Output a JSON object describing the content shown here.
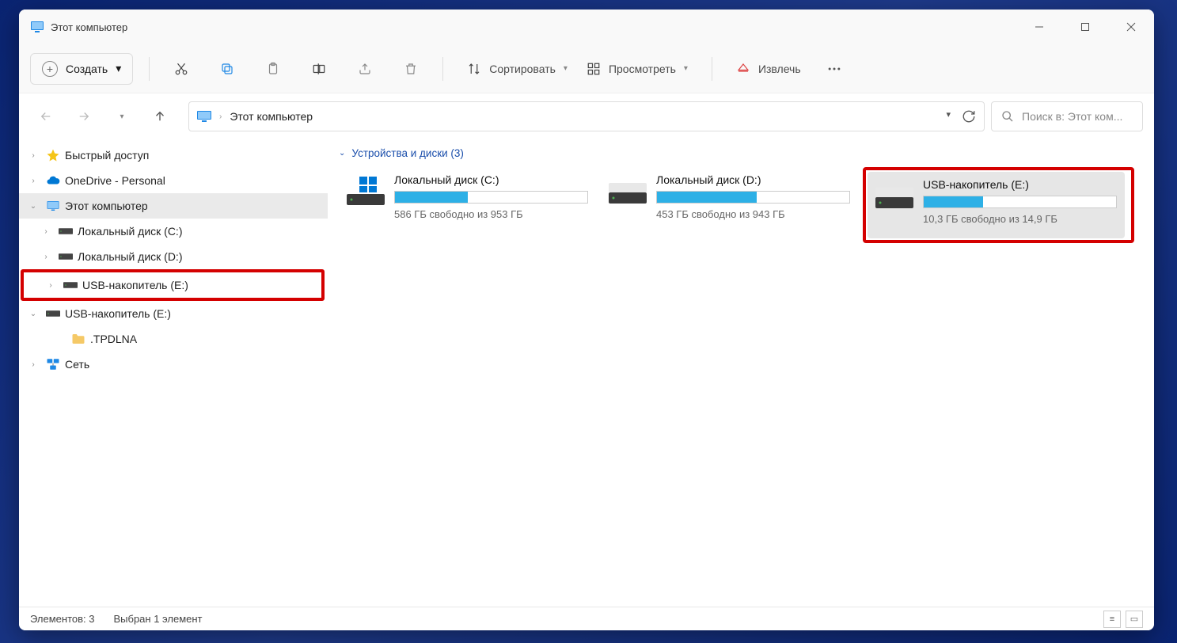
{
  "window": {
    "title": "Этот компьютер"
  },
  "toolbar": {
    "new_label": "Создать",
    "sort_label": "Сортировать",
    "view_label": "Просмотреть",
    "eject_label": "Извлечь"
  },
  "address": {
    "crumb": "Этот компьютер"
  },
  "search": {
    "placeholder": "Поиск в: Этот ком..."
  },
  "sidebar": {
    "items": [
      {
        "icon": "star",
        "label": "Быстрый доступ",
        "expander": ">",
        "pad": "pad0"
      },
      {
        "icon": "cloud",
        "label": "OneDrive - Personal",
        "expander": ">",
        "pad": "pad0"
      },
      {
        "icon": "pc",
        "label": "Этот компьютер",
        "expander": "v",
        "pad": "pad0",
        "selected": true
      },
      {
        "icon": "drive",
        "label": "Локальный диск (C:)",
        "expander": ">",
        "pad": "pad1"
      },
      {
        "icon": "drive",
        "label": "Локальный диск (D:)",
        "expander": ">",
        "pad": "pad1"
      },
      {
        "icon": "drive",
        "label": "USB-накопитель (E:)",
        "expander": ">",
        "pad": "pad1",
        "highlight": true
      },
      {
        "icon": "drive",
        "label": "USB-накопитель (E:)",
        "expander": "v",
        "pad": "pad0"
      },
      {
        "icon": "folder",
        "label": ".TPDLNA",
        "expander": "",
        "pad": "pad2"
      },
      {
        "icon": "network",
        "label": "Сеть",
        "expander": ">",
        "pad": "pad0"
      }
    ]
  },
  "content": {
    "section_label": "Устройства и диски (3)",
    "drives": [
      {
        "name": "Локальный диск (C:)",
        "free": "586 ГБ свободно из 953 ГБ",
        "fill_pct": 38,
        "type": "os"
      },
      {
        "name": "Локальный диск (D:)",
        "free": "453 ГБ свободно из 943 ГБ",
        "fill_pct": 52,
        "type": "hdd"
      },
      {
        "name": "USB-накопитель (E:)",
        "free": "10,3 ГБ свободно из 14,9 ГБ",
        "fill_pct": 31,
        "type": "hdd",
        "selected": true,
        "highlight": true
      }
    ]
  },
  "status": {
    "items_count": "Элементов: 3",
    "selected": "Выбран 1 элемент"
  }
}
